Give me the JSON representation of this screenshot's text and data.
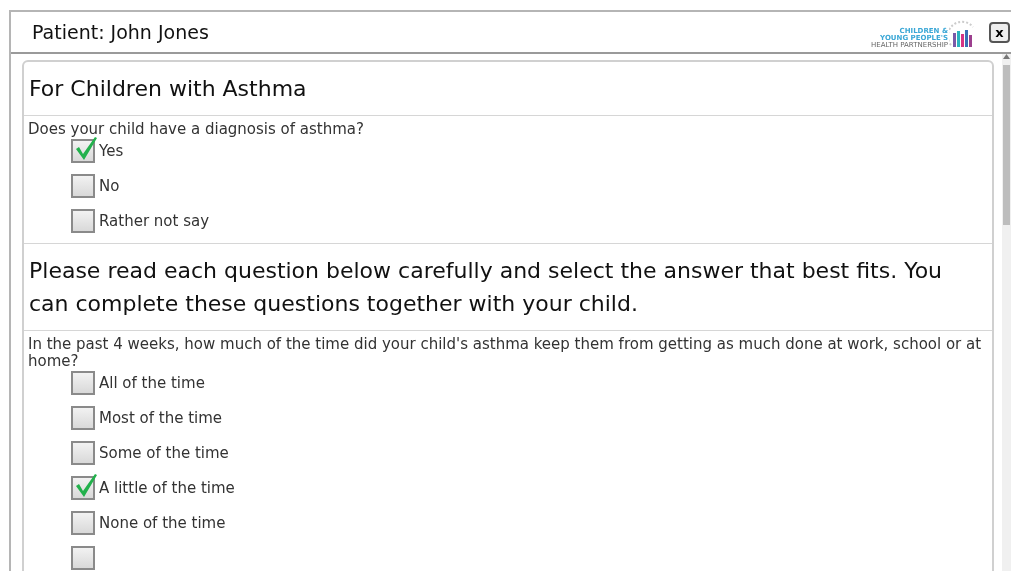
{
  "window": {
    "title": "Patient: John Jones",
    "close": "x"
  },
  "logo": {
    "lines": [
      "CHILDREN &",
      "YOUNG PEOPLE'S",
      "HEALTH PARTNERSHIP"
    ]
  },
  "sections": [
    {
      "kind": "heading",
      "text": "For Children with Asthma"
    },
    {
      "kind": "question",
      "text": "Does your child have a diagnosis of asthma?",
      "options": [
        {
          "label": "Yes",
          "checked": true
        },
        {
          "label": "No",
          "checked": false
        },
        {
          "label": "Rather not say",
          "checked": false
        }
      ]
    },
    {
      "kind": "heading",
      "text": "Please read each question below carefully and select the answer that best fits. You can complete these questions together with your child."
    },
    {
      "kind": "question",
      "text": "In the past 4 weeks, how much of the time did your child's asthma keep them from getting as much done at work, school or at home?",
      "options": [
        {
          "label": "All of the time",
          "checked": false
        },
        {
          "label": "Most of the time",
          "checked": false
        },
        {
          "label": "Some of the time",
          "checked": false
        },
        {
          "label": "A little of the time",
          "checked": true
        },
        {
          "label": "None of the time",
          "checked": false
        },
        {
          "checked": false
        }
      ]
    }
  ]
}
